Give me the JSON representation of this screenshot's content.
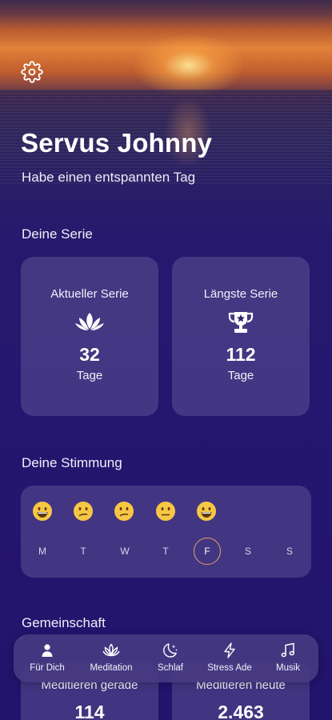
{
  "header": {
    "greeting": "Servus Johnny",
    "subtitle": "Habe einen entspannten Tag"
  },
  "icons": {
    "settings": "gear-icon",
    "current_streak": "lotus-icon",
    "longest_streak": "trophy-icon"
  },
  "streak": {
    "title": "Deine Serie",
    "current": {
      "label": "Aktueller Serie",
      "value": "32",
      "unit": "Tage"
    },
    "longest": {
      "label": "Längste Serie",
      "value": "112",
      "unit": "Tage"
    }
  },
  "mood": {
    "title": "Deine Stimmung",
    "entries": [
      {
        "day": "M",
        "mood": "grinning"
      },
      {
        "day": "T",
        "mood": "confused"
      },
      {
        "day": "W",
        "mood": "confused"
      },
      {
        "day": "T",
        "mood": "neutral"
      },
      {
        "day": "F",
        "mood": "grinning"
      },
      {
        "day": "S",
        "mood": null
      },
      {
        "day": "S",
        "mood": null
      }
    ],
    "active_day_index": 4
  },
  "community": {
    "title": "Gemeinschaft",
    "now": {
      "label": "Meditieren gerade",
      "value": "114"
    },
    "today": {
      "label": "Meditieren heute",
      "value": "2.463"
    }
  },
  "tabbar": {
    "items": [
      {
        "label": "Für Dich",
        "icon": "person-icon"
      },
      {
        "label": "Meditation",
        "icon": "lotus-icon"
      },
      {
        "label": "Schlaf",
        "icon": "moon-stars-icon"
      },
      {
        "label": "Stress Ade",
        "icon": "lightning-icon"
      },
      {
        "label": "Musik",
        "icon": "music-note-icon"
      }
    ],
    "active_index": 0
  },
  "colors": {
    "background": "#24156f",
    "card": "rgba(255,255,255,0.14)",
    "active_day_ring": "#e8a06a",
    "emoji_face": "#f6c744"
  }
}
